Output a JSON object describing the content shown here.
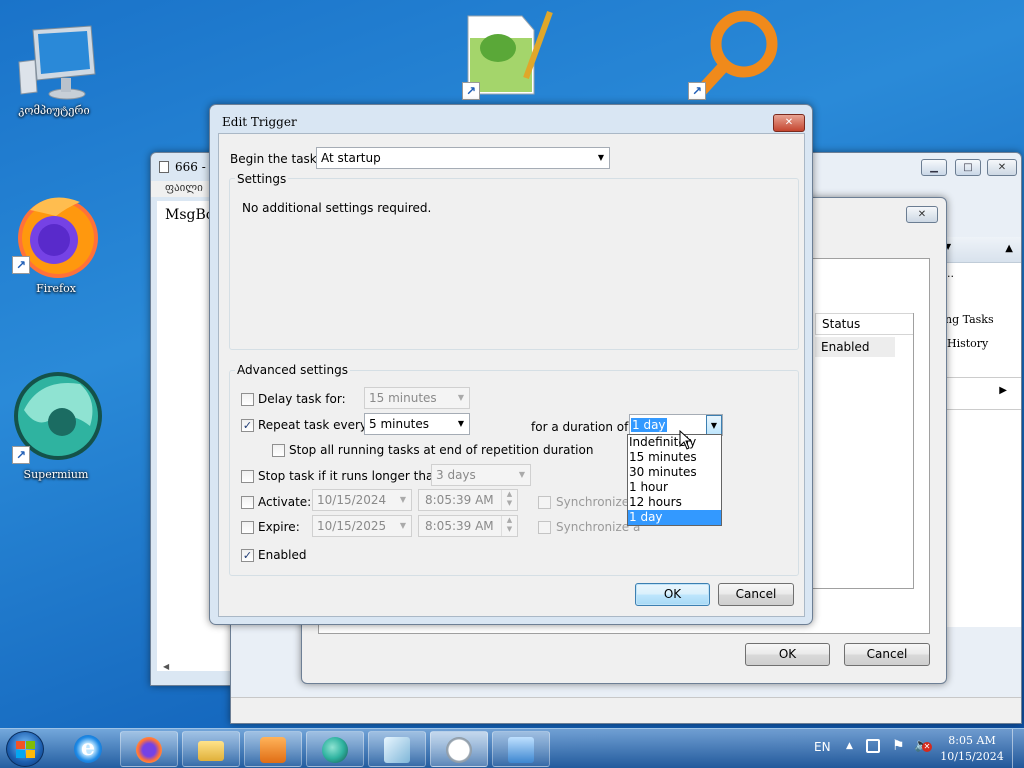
{
  "desktop": {
    "icons": [
      {
        "label": "კომპიუტერი"
      },
      {
        "label": "Firefox"
      },
      {
        "label": "Supermium"
      }
    ]
  },
  "bg_window": {
    "title": "666 -",
    "menu_item": "ფაილი",
    "content": "MsgBo"
  },
  "middle_window": {
    "columns": {
      "status": "Status"
    },
    "status_value": "Enabled",
    "right_items": [
      "..",
      "ng Tasks",
      "History"
    ],
    "ok": "OK",
    "cancel": "Cancel"
  },
  "dialog": {
    "title": "Edit Trigger",
    "begin_label": "Begin the task:",
    "begin_value": "At startup",
    "settings_label": "Settings",
    "settings_text": "No additional settings required.",
    "advanced_label": "Advanced settings",
    "delay_label": "Delay task for:",
    "delay_value": "15 minutes",
    "repeat_label": "Repeat task every:",
    "repeat_value": "5 minutes",
    "duration_label": "for a duration of:",
    "duration_value": "1 day",
    "duration_options": [
      "Indefinitely",
      "15 minutes",
      "30 minutes",
      "1 hour",
      "12 hours",
      "1 day"
    ],
    "stop_all_label": "Stop all running tasks at end of repetition duration",
    "stop_if_label": "Stop task if it runs longer than:",
    "stop_if_value": "3 days",
    "activate_label": "Activate:",
    "activate_date": "10/15/2024",
    "activate_time": "8:05:39 AM",
    "expire_label": "Expire:",
    "expire_date": "10/15/2025",
    "expire_time": "8:05:39 AM",
    "sync_label_1": "Synchronize a",
    "sync_label_2": "Synchronize a",
    "enabled_label": "Enabled",
    "ok": "OK",
    "cancel": "Cancel"
  },
  "taskbar": {
    "lang": "EN",
    "time": "8:05 AM",
    "date": "10/15/2024"
  },
  "colors": {
    "selection": "#3399ff",
    "accent": "#1669bf"
  }
}
